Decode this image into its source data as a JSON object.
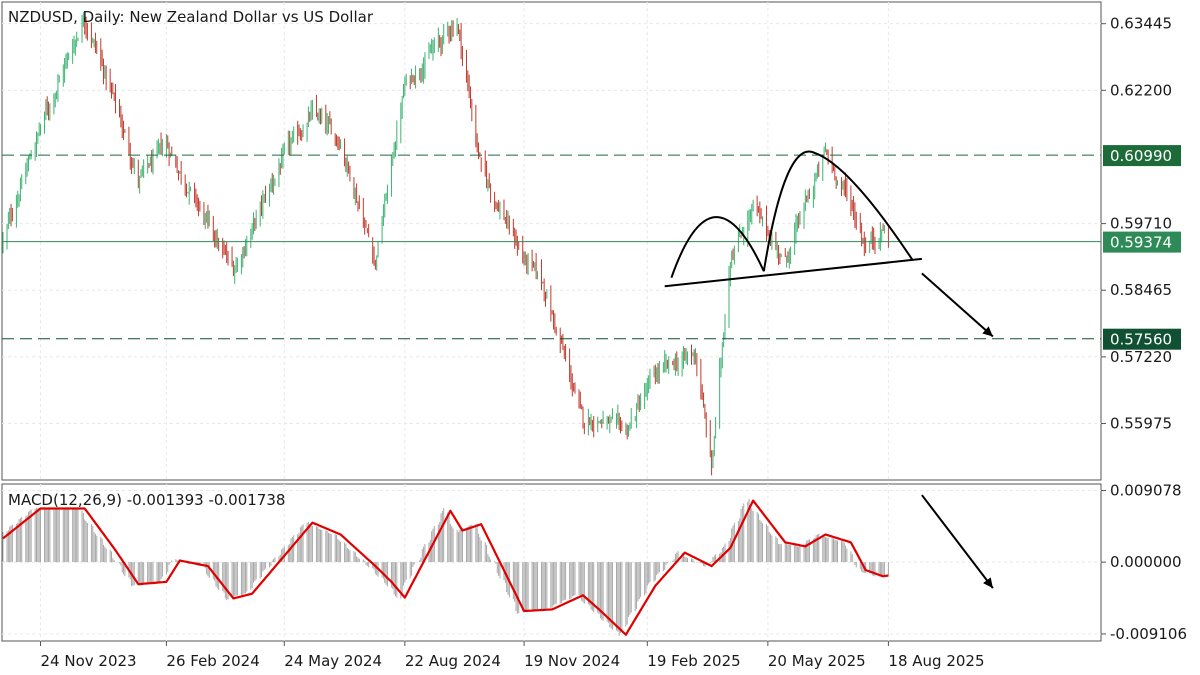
{
  "chart_data": {
    "type": "candlestick",
    "title": "NZDUSD, Daily:  New Zealand Dollar vs US Dollar",
    "price_axis": {
      "ticks": [
        "0.63445",
        "0.62200",
        "0.59710",
        "0.58465",
        "0.57220",
        "0.55975"
      ],
      "range": [
        0.5492,
        0.6385
      ]
    },
    "x_axis": {
      "ticks": [
        "24 Nov 2023",
        "26 Feb 2024",
        "24 May 2024",
        "22 Aug 2024",
        "19 Nov 2024",
        "19 Feb 2025",
        "20 May 2025",
        "18 Aug 2025"
      ]
    },
    "levels": [
      {
        "name": "resistance",
        "value": 0.6099,
        "label": "0.60990",
        "style": "dashed",
        "color": "#1e6b3a"
      },
      {
        "name": "current-price",
        "value": 0.59374,
        "label": "0.59374",
        "style": "solid",
        "color": "#2e8b57"
      },
      {
        "name": "target",
        "value": 0.5756,
        "label": "0.57560",
        "style": "dashed",
        "color": "#0f5132"
      }
    ],
    "pattern": {
      "name": "head-and-shoulders",
      "neckline": [
        {
          "date": "2025-03-04",
          "value": 0.5854
        },
        {
          "date": "2025-09-12",
          "value": 0.5905
        }
      ]
    },
    "price_path": [
      {
        "date": "2023-10-27",
        "value": 0.5938
      },
      {
        "date": "2023-11-24",
        "value": 0.6152
      },
      {
        "date": "2023-12-27",
        "value": 0.6359
      },
      {
        "date": "2024-01-19",
        "value": 0.6195
      },
      {
        "date": "2024-02-05",
        "value": 0.6052
      },
      {
        "date": "2024-02-26",
        "value": 0.6118
      },
      {
        "date": "2024-03-28",
        "value": 0.5968
      },
      {
        "date": "2024-04-16",
        "value": 0.5882
      },
      {
        "date": "2024-05-24",
        "value": 0.6098
      },
      {
        "date": "2024-06-14",
        "value": 0.6177
      },
      {
        "date": "2024-07-05",
        "value": 0.6125
      },
      {
        "date": "2024-07-31",
        "value": 0.5902
      },
      {
        "date": "2024-08-22",
        "value": 0.623
      },
      {
        "date": "2024-09-30",
        "value": 0.635
      },
      {
        "date": "2024-10-18",
        "value": 0.6073
      },
      {
        "date": "2024-11-19",
        "value": 0.5905
      },
      {
        "date": "2024-12-03",
        "value": 0.586
      },
      {
        "date": "2025-01-02",
        "value": 0.5601
      },
      {
        "date": "2025-01-14",
        "value": 0.5606
      },
      {
        "date": "2025-02-03",
        "value": 0.5582
      },
      {
        "date": "2025-02-25",
        "value": 0.5689
      },
      {
        "date": "2025-03-27",
        "value": 0.5728
      },
      {
        "date": "2025-04-08",
        "value": 0.5516
      },
      {
        "date": "2025-04-22",
        "value": 0.5911
      },
      {
        "date": "2025-05-09",
        "value": 0.6
      },
      {
        "date": "2025-06-02",
        "value": 0.5899
      },
      {
        "date": "2025-06-10",
        "value": 0.5957
      },
      {
        "date": "2025-07-02",
        "value": 0.6103
      },
      {
        "date": "2025-07-21",
        "value": 0.601
      },
      {
        "date": "2025-08-01",
        "value": 0.593
      },
      {
        "date": "2025-08-14",
        "value": 0.5962
      },
      {
        "date": "2025-08-18",
        "value": 0.5937
      }
    ],
    "macd": {
      "label": "MACD(12,26,9) -0.001393 -0.001738",
      "ticks": [
        "0.009078",
        "0.000000",
        "-0.009106"
      ],
      "range": [
        -0.01,
        0.0099
      ],
      "signal": [
        {
          "date": "2023-10-27",
          "value": 0.003
        },
        {
          "date": "2023-11-24",
          "value": 0.0068
        },
        {
          "date": "2023-12-27",
          "value": 0.0068
        },
        {
          "date": "2024-01-19",
          "value": 0.0015
        },
        {
          "date": "2024-02-05",
          "value": -0.0028
        },
        {
          "date": "2024-02-26",
          "value": -0.0025
        },
        {
          "date": "2024-03-07",
          "value": 0.0002
        },
        {
          "date": "2024-03-28",
          "value": -0.0005
        },
        {
          "date": "2024-04-16",
          "value": -0.0046
        },
        {
          "date": "2024-04-30",
          "value": -0.004
        },
        {
          "date": "2024-05-24",
          "value": 0.0008
        },
        {
          "date": "2024-06-14",
          "value": 0.005
        },
        {
          "date": "2024-07-05",
          "value": 0.0035
        },
        {
          "date": "2024-07-31",
          "value": -0.0005
        },
        {
          "date": "2024-08-12",
          "value": -0.0025
        },
        {
          "date": "2024-08-22",
          "value": -0.0045
        },
        {
          "date": "2024-09-25",
          "value": 0.0065
        },
        {
          "date": "2024-10-04",
          "value": 0.004
        },
        {
          "date": "2024-10-18",
          "value": 0.0048
        },
        {
          "date": "2024-11-19",
          "value": -0.0062
        },
        {
          "date": "2024-12-10",
          "value": -0.006
        },
        {
          "date": "2025-01-02",
          "value": -0.0042
        },
        {
          "date": "2025-01-14",
          "value": -0.006
        },
        {
          "date": "2025-02-03",
          "value": -0.0092
        },
        {
          "date": "2025-02-25",
          "value": -0.003
        },
        {
          "date": "2025-03-19",
          "value": 0.0012
        },
        {
          "date": "2025-04-08",
          "value": -0.0005
        },
        {
          "date": "2025-04-22",
          "value": 0.0018
        },
        {
          "date": "2025-05-09",
          "value": 0.0078
        },
        {
          "date": "2025-06-02",
          "value": 0.0025
        },
        {
          "date": "2025-06-17",
          "value": 0.002
        },
        {
          "date": "2025-07-02",
          "value": 0.0035
        },
        {
          "date": "2025-07-21",
          "value": 0.0025
        },
        {
          "date": "2025-08-01",
          "value": -0.001
        },
        {
          "date": "2025-08-14",
          "value": -0.0018
        },
        {
          "date": "2025-08-18",
          "value": -0.0017
        }
      ]
    },
    "colors": {
      "up": "#3cb371",
      "down": "#c0392b",
      "grid": "#e8e8e8",
      "macd_line": "#e00000",
      "histogram": "#a8a8a8"
    }
  }
}
